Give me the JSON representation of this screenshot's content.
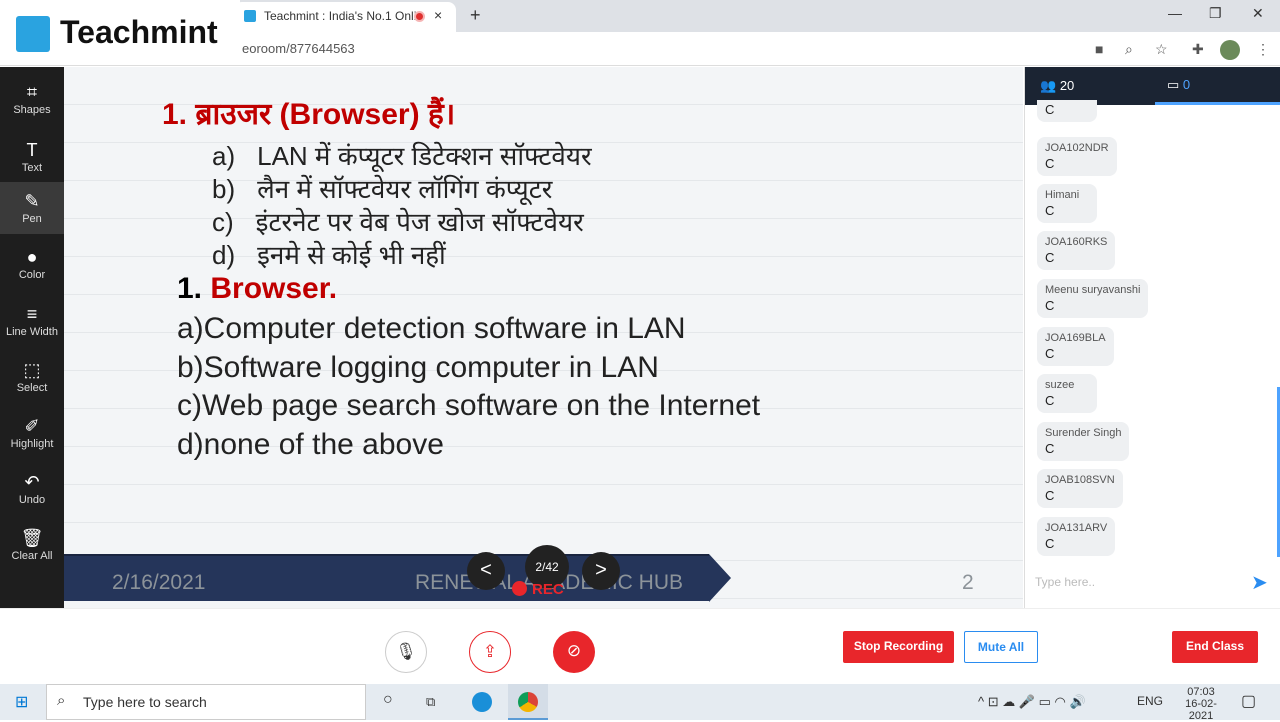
{
  "browser": {
    "tab_title": "Teachmint : India's No.1 Onli",
    "url": "eoroom/877644563",
    "new_tab": "+",
    "close_tab": "×"
  },
  "logo": {
    "text": "Teachmint"
  },
  "toolbar": [
    {
      "icon": "shapes-icon",
      "glyph": "⌗",
      "label": "Shapes"
    },
    {
      "icon": "text-icon",
      "glyph": "T",
      "label": "Text"
    },
    {
      "icon": "pen-icon",
      "glyph": "✎",
      "label": "Pen"
    },
    {
      "icon": "color-icon",
      "glyph": "●",
      "label": "Color"
    },
    {
      "icon": "line-width-icon",
      "glyph": "≡",
      "label": "Line Width"
    },
    {
      "icon": "select-icon",
      "glyph": "⬚",
      "label": "Select"
    },
    {
      "icon": "highlight-icon",
      "glyph": "✐",
      "label": "Highlight"
    },
    {
      "icon": "undo-icon",
      "glyph": "↶",
      "label": "Undo"
    },
    {
      "icon": "clear-all-icon",
      "glyph": "🗑",
      "label": "Clear All"
    }
  ],
  "slide": {
    "hindi_question": "1. ब्राउजर (Browser) हैं।",
    "hindi_options": [
      {
        "l": "a)",
        "t": "LAN में कंप्यूटर डिटेक्शन सॉफ्टवेयर"
      },
      {
        "l": "b)",
        "t": "लैन में सॉफ्टवेयर लॉगिंग कंप्यूटर"
      },
      {
        "l": "c)",
        "t": "इंटरनेट पर वेब पेज खोज सॉफ्टवेयर"
      },
      {
        "l": "d)",
        "t": "इनमे से कोई भी नहीं"
      }
    ],
    "en_num": "1. ",
    "en_question": "Browser.",
    "en_options": [
      "a)Computer detection software in LAN",
      "b)Software logging computer in LAN",
      "c)Web page search software on the Internet",
      "d)none of the above"
    ],
    "footer_date": "2/16/2021",
    "footer_text": "RENEWAL ACADEMIC HUB",
    "footer_page": "2",
    "prev": "<",
    "next": ">",
    "page_counter": "2/42",
    "rec": "REC"
  },
  "chat": {
    "participants": "20",
    "messages_count": "0",
    "placeholder": "Type here..",
    "messages": [
      {
        "name": "",
        "text": "C"
      },
      {
        "name": "JOA102NDR",
        "text": "C"
      },
      {
        "name": "Himani",
        "text": "C"
      },
      {
        "name": "JOA160RKS",
        "text": "C"
      },
      {
        "name": "Meenu suryavanshi",
        "text": "C"
      },
      {
        "name": "JOA169BLA",
        "text": "C"
      },
      {
        "name": "suzee",
        "text": "C"
      },
      {
        "name": "Surender Singh",
        "text": "C"
      },
      {
        "name": "JOAB108SVN",
        "text": "C"
      },
      {
        "name": "JOA131ARV",
        "text": "C"
      }
    ]
  },
  "controls": {
    "stop_recording": "Stop Recording",
    "mute_all": "Mute All",
    "end_class": "End Class",
    "accent": "#e8262b"
  },
  "taskbar": {
    "search_placeholder": "Type here to search",
    "lang": "ENG",
    "time": "07:03",
    "date": "16-02-2021"
  }
}
